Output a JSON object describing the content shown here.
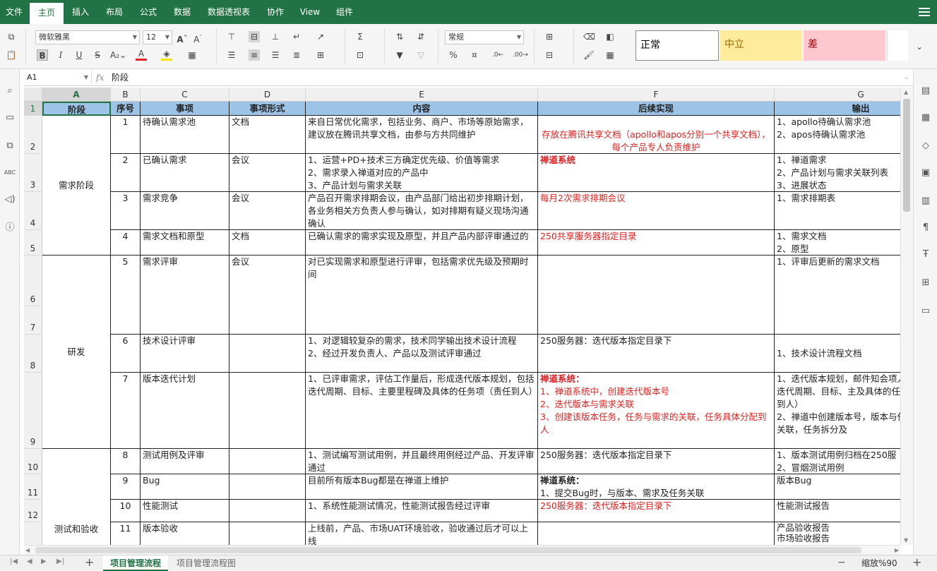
{
  "menu": {
    "file": "文件",
    "tabs": [
      "主页",
      "插入",
      "布局",
      "公式",
      "数据",
      "数据透视表",
      "协作",
      "View",
      "组件"
    ],
    "active_tab": "主页"
  },
  "ribbon": {
    "font_name": "微软雅黑",
    "font_size": "12",
    "number_format": "常规",
    "styles": {
      "normal": "正常",
      "neutral": "中立",
      "bad": "差"
    }
  },
  "formula_bar": {
    "cell_ref": "A1",
    "fx": "fx",
    "value": "阶段"
  },
  "columns": [
    "A",
    "B",
    "C",
    "D",
    "E",
    "F",
    "G"
  ],
  "rows": [
    "1",
    "2",
    "3",
    "4",
    "5",
    "6",
    "7",
    "8",
    "9",
    "10",
    "11",
    "12"
  ],
  "table": {
    "headers": {
      "a": "阶段",
      "b": "序号",
      "c": "事项",
      "d": "事项形式",
      "e": "内容",
      "f": "后续实现",
      "g": "输出"
    },
    "stages": {
      "req": "需求阶段",
      "dev": "研发",
      "test": "测试和验收"
    },
    "items": [
      {
        "no": "1",
        "item": "待确认需求池",
        "form": "文档",
        "content": "来自日常优化需求，包括业务、商户、市场等原始需求，建议放在腾讯共享文档，由参与方共同维护",
        "impl": "存放在腾讯共享文档（apollo和apos分别一个共享文档），每个产品专人负责维护",
        "output": "1、apollo待确认需求池\n2、apos待确认需求池"
      },
      {
        "no": "2",
        "item": "已确认需求",
        "form": "会议",
        "content": "1、运营+PD+技术三方确定优先级、价值等需求\n2、需求录入禅道对应的产品中\n3、产品计划与需求关联",
        "impl": "禅道系统",
        "output": "1、禅道需求\n2、产品计划与需求关联列表\n3、进展状态"
      },
      {
        "no": "3",
        "item": "需求竞争",
        "form": "会议",
        "content": "产品召开需求排期会议，由产品部门给出初步排期计划，各业务相关方负责人参与确认，如对排期有疑义现场沟通确认",
        "impl": "每月2次需求排期会议",
        "output": "1、需求排期表"
      },
      {
        "no": "4",
        "item": "需求文档和原型",
        "form": "文档",
        "content": "已确认需求的需求实现及原型，并且产品内部评审通过的",
        "impl": "250共享服务器指定目录",
        "output": "1、需求文档\n2、原型"
      },
      {
        "no": "5",
        "item": "需求评审",
        "form": "会议",
        "content": "对已实现需求和原型进行评审，包括需求优先级及预期时间",
        "impl": "",
        "output": "1、评审后更新的需求文档"
      },
      {
        "no": "6",
        "item": "技术设计评审",
        "form": "",
        "content": "1、对逻辑较复杂的需求，技术同学输出技术设计流程\n2、经过开发负责人、产品以及测试评审通过",
        "impl": "250服务器：迭代版本指定目录下",
        "output": "1、技术设计流程文档"
      },
      {
        "no": "7",
        "item": "版本迭代计划",
        "form": "",
        "content": "1、已评审需求，评估工作量后，形成迭代版本规划，包括迭代周期、目标、主要里程碑及具体的任务项（责任到人）",
        "impl_title": "禅道系统：",
        "impl": "1、禅道系统中，创建迭代版本号\n2、迭代版本与需求关联\n3、创建该版本任务，任务与需求的关联，任务具体分配到人",
        "output": "1、迭代版本规划，邮件知会项人员，包括迭代周期、目标、主及具体的任务项（责任到人）\n2、禅道中创建版本号，版本与任务与需求关联，任务拆分及"
      },
      {
        "no": "8",
        "item": "测试用例及评审",
        "form": "",
        "content": "1、测试编写测试用例，并且最终用例经过产品、开发评审通过",
        "impl": "250服务器：迭代版本指定目录下",
        "output": "1、版本测试用例归档在250服\n2、冒烟测试用例"
      },
      {
        "no": "9",
        "item": "Bug",
        "form": "",
        "content": "目前所有版本Bug都是在禅道上维护",
        "impl_title": "禅道系统：",
        "impl": "1、提交Bug时，与版本、需求及任务关联",
        "output": "版本Bug"
      },
      {
        "no": "10",
        "item": "性能测试",
        "form": "",
        "content": "1、系统性能测试情况，性能测试报告经过评审",
        "impl": "250服务器：迭代版本指定目录下",
        "output": "性能测试报告"
      },
      {
        "no": "11",
        "item": "版本验收",
        "form": "",
        "content": "上线前，产品、市场UAT环境验收，验收通过后才可以上线",
        "impl": "",
        "output": "产品验收报告\n市场验收报告"
      }
    ]
  },
  "sheets": [
    "项目管理流程",
    "项目管理流程图"
  ],
  "active_sheet": "项目管理流程",
  "status": {
    "zoom": "缩放%90",
    "minus": "−",
    "plus": "+"
  },
  "colors": {
    "brand": "#217346",
    "header_fill": "#9dc3e6",
    "red_text": "#e02020",
    "neutral_fill": "#ffeb9c",
    "bad_fill": "#ffc7ce"
  }
}
